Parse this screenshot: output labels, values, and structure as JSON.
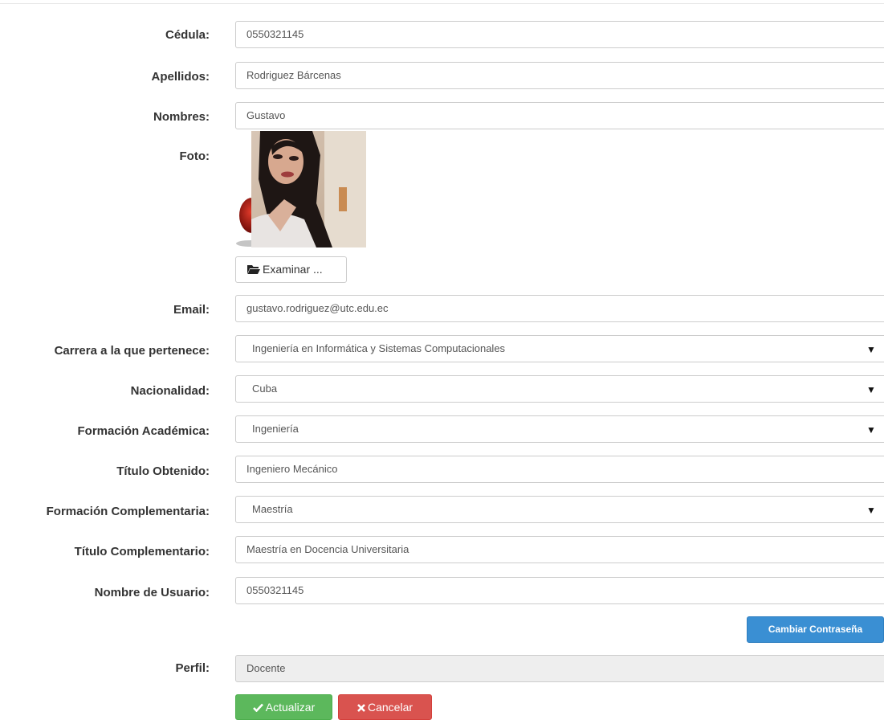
{
  "form": {
    "cedula": {
      "label": "Cédula:",
      "value": "0550321145"
    },
    "apellidos": {
      "label": "Apellidos:",
      "value": "Rodriguez Bárcenas"
    },
    "nombres": {
      "label": "Nombres:",
      "value": "Gustavo"
    },
    "foto": {
      "label": "Foto:",
      "browse_label": "Examinar ...",
      "icon": "folder-open-icon"
    },
    "email": {
      "label": "Email:",
      "value": "gustavo.rodriguez@utc.edu.ec"
    },
    "carrera": {
      "label": "Carrera a la que pertenece:",
      "value": "Ingeniería en Informática y Sistemas Computacionales"
    },
    "nacionalidad": {
      "label": "Nacionalidad:",
      "value": "Cuba"
    },
    "formacion_academica": {
      "label": "Formación Académica:",
      "value": "Ingeniería"
    },
    "titulo_obtenido": {
      "label": "Título Obtenido:",
      "value": "Ingeniero Mecánico"
    },
    "formacion_complementaria": {
      "label": "Formación Complementaria:",
      "value": "Maestría"
    },
    "titulo_complementario": {
      "label": "Título Complementario:",
      "value": "Maestría en Docencia Universitaria"
    },
    "nombre_usuario": {
      "label": "Nombre de Usuario:",
      "value": "0550321145"
    },
    "perfil": {
      "label": "Perfil:",
      "value": "Docente"
    }
  },
  "buttons": {
    "cambiar_contrasena": "Cambiar Contraseña",
    "actualizar": "Actualizar",
    "cancelar": "Cancelar"
  },
  "icons": {
    "caret": "▼",
    "update": "check-icon",
    "cancel": "times-icon"
  },
  "colors": {
    "primary": "#3a8fd3",
    "success": "#5cb85c",
    "danger": "#d9534f",
    "readonly_bg": "#eeeeee",
    "border": "#cccccc"
  }
}
